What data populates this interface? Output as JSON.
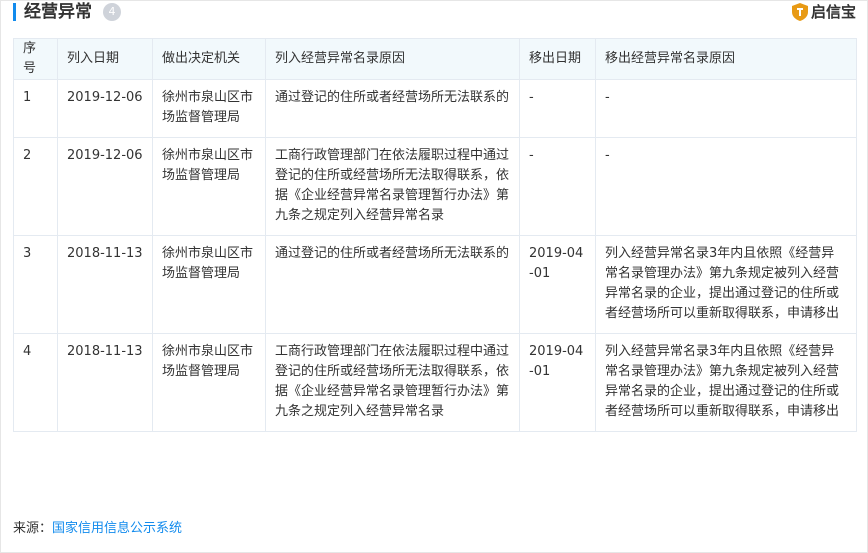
{
  "header": {
    "title": "经营异常",
    "count": "4",
    "brand_name": "启信宝",
    "brand_color": "#e89a14",
    "accent_color": "#128bed"
  },
  "table": {
    "columns": [
      "序号",
      "列入日期",
      "做出决定机关",
      "列入经营异常名录原因",
      "移出日期",
      "移出经营异常名录原因"
    ],
    "rows": [
      {
        "no": "1",
        "listed_date": "2019-12-06",
        "authority": "徐州市泉山区市场监督管理局",
        "listed_reason": "通过登记的住所或者经营场所无法联系的",
        "removed_date": "-",
        "removed_reason": "-"
      },
      {
        "no": "2",
        "listed_date": "2019-12-06",
        "authority": "徐州市泉山区市场监督管理局",
        "listed_reason": "工商行政管理部门在依法履职过程中通过登记的住所或经营场所无法取得联系，依据《企业经营异常名录管理暂行办法》第九条之规定列入经营异常名录",
        "removed_date": "-",
        "removed_reason": "-"
      },
      {
        "no": "3",
        "listed_date": "2018-11-13",
        "authority": "徐州市泉山区市场监督管理局",
        "listed_reason": "通过登记的住所或者经营场所无法联系的",
        "removed_date": "2019-04-01",
        "removed_reason": "列入经营异常名录3年内且依照《经营异常名录管理办法》第九条规定被列入经营异常名录的企业，提出通过登记的住所或者经营场所可以重新取得联系，申请移出"
      },
      {
        "no": "4",
        "listed_date": "2018-11-13",
        "authority": "徐州市泉山区市场监督管理局",
        "listed_reason": "工商行政管理部门在依法履职过程中通过登记的住所或经营场所无法取得联系，依据《企业经营异常名录管理暂行办法》第九条之规定列入经营异常名录",
        "removed_date": "2019-04-01",
        "removed_reason": "列入经营异常名录3年内且依照《经营异常名录管理办法》第九条规定被列入经营异常名录的企业，提出通过登记的住所或者经营场所可以重新取得联系，申请移出"
      }
    ]
  },
  "footer": {
    "source_label": "来源：",
    "source_link": "国家信用信息公示系统"
  }
}
